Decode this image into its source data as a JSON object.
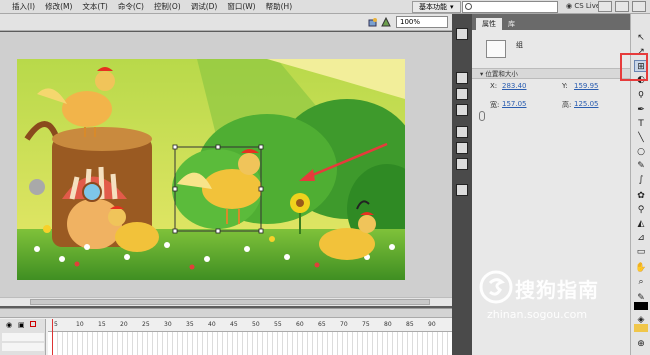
{
  "menubar": {
    "items": [
      "插入(I)",
      "修改(M)",
      "文本(T)",
      "命令(C)",
      "控制(O)",
      "调试(D)",
      "窗口(W)",
      "帮助(H)"
    ],
    "workspace": "基本功能",
    "search_placeholder": "",
    "cs_live": "CS Live"
  },
  "stage": {
    "zoom": "100%"
  },
  "timeline": {
    "frame_numbers": [
      "5",
      "10",
      "15",
      "20",
      "25",
      "30",
      "35",
      "40",
      "45",
      "50",
      "55",
      "60",
      "65",
      "70",
      "75",
      "80",
      "85",
      "90"
    ]
  },
  "properties": {
    "tabs": [
      "属性",
      "库"
    ],
    "object_name": "组",
    "section_title": "位置和大小",
    "x_label": "X:",
    "x_value": "283.40",
    "y_label": "Y:",
    "y_value": "159.95",
    "width_label": "宽:",
    "width_value": "157.05",
    "height_label": "高:",
    "height_value": "125.05"
  },
  "watermark": {
    "title": "搜狗指南",
    "subtitle": "zhinan.sogou.com"
  },
  "colors": {
    "highlight": "#e63b3b",
    "link_value": "#2a5db0"
  }
}
